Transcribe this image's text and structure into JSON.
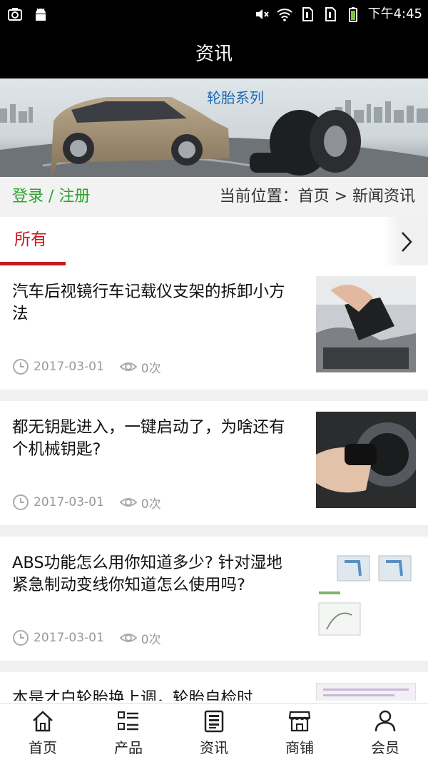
{
  "status_bar": {
    "time": "下午4:45",
    "icons": [
      "screenshot-icon",
      "android-icon",
      "mute-icon",
      "wifi-icon",
      "sim1-icon",
      "sim2-icon",
      "battery-icon"
    ]
  },
  "header": {
    "title": "资讯"
  },
  "banner": {
    "label": "轮胎系列"
  },
  "infobar": {
    "login": "登录",
    "separator": " / ",
    "register": "注册",
    "breadcrumb": "当前位置：首页 > 新闻资讯"
  },
  "tabs": {
    "active": "所有",
    "accent": "#c8171e"
  },
  "news": [
    {
      "title": "汽车后视镜行车记载仪支架的拆卸小方法",
      "date": "2017-03-01",
      "views": "0次"
    },
    {
      "title": "都无钥匙进入，一键启动了，为啥还有个机械钥匙?",
      "date": "2017-03-01",
      "views": "0次"
    },
    {
      "title": "ABS功能怎么用你知道多少? 针对湿地紧急制动变线你知道怎么使用吗?",
      "date": "2017-03-01",
      "views": "0次"
    },
    {
      "title": "本是才白轮胎换上调，轮胎自检时",
      "date": "",
      "views": ""
    }
  ],
  "bottom_nav": [
    {
      "label": "首页",
      "icon": "home-icon"
    },
    {
      "label": "产品",
      "icon": "list-icon"
    },
    {
      "label": "资讯",
      "icon": "news-icon"
    },
    {
      "label": "商铺",
      "icon": "shop-icon"
    },
    {
      "label": "会员",
      "icon": "user-icon"
    }
  ],
  "colors": {
    "green": "#2fa22f",
    "red": "#c8171e",
    "header": "#000000"
  }
}
